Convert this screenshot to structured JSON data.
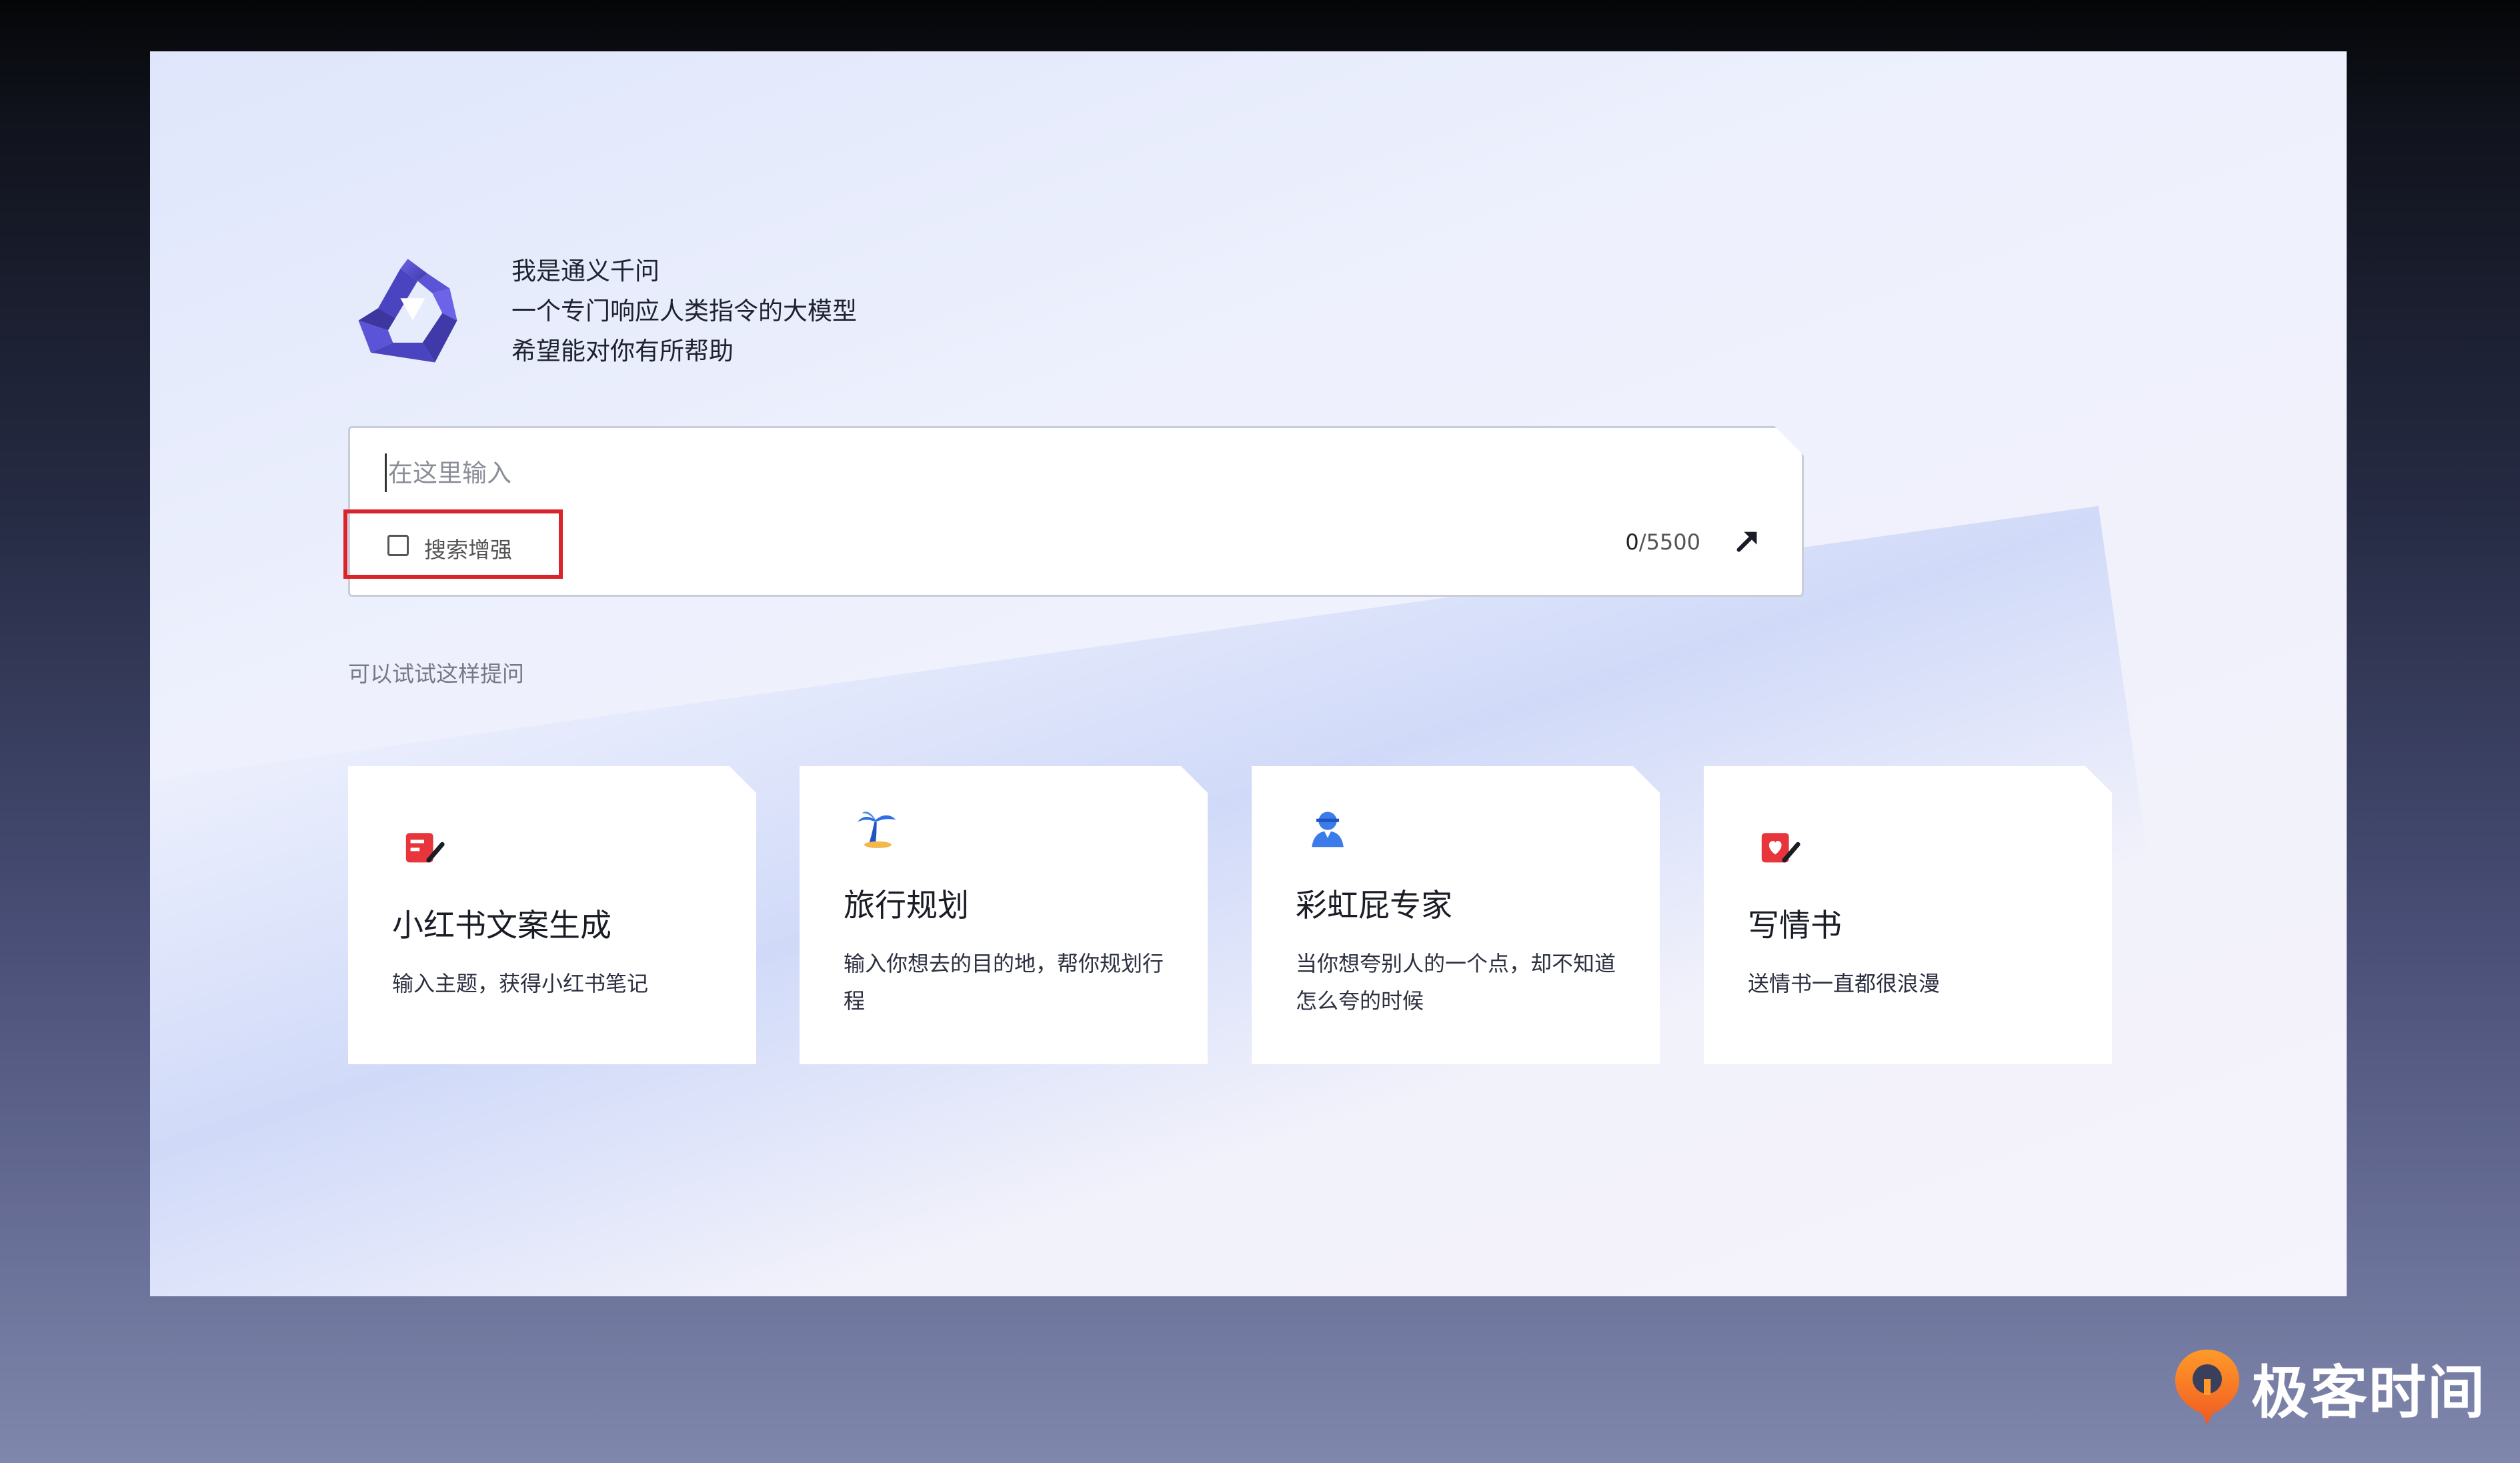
{
  "intro": {
    "line1": "我是通义千问",
    "line2": "一个专门响应人类指令的大模型",
    "line3": "希望能对你有所帮助"
  },
  "input": {
    "placeholder": "在这里输入",
    "value": ""
  },
  "search_enhance": {
    "label": "搜索增强",
    "checked": false
  },
  "counter": {
    "current": "0",
    "max": "/5500"
  },
  "hint": "可以试试这样提问",
  "cards": [
    {
      "title": "小红书文案生成",
      "desc": "输入主题，获得小红书笔记",
      "icon": "red-note-icon"
    },
    {
      "title": "旅行规划",
      "desc": "输入你想去的目的地，帮你规划行程",
      "icon": "palm-tree-icon"
    },
    {
      "title": "彩虹屁专家",
      "desc": "当你想夸别人的一个点，却不知道怎么夸的时候",
      "icon": "person-icon"
    },
    {
      "title": "写情书",
      "desc": "送情书一直都很浪漫",
      "icon": "love-letter-icon"
    }
  ],
  "brand": {
    "name": "极客时间"
  },
  "colors": {
    "logo": "#5b54d6",
    "highlight_border": "#d8242a",
    "red_icon": "#e8353b",
    "blue_icon": "#3b7bea"
  }
}
